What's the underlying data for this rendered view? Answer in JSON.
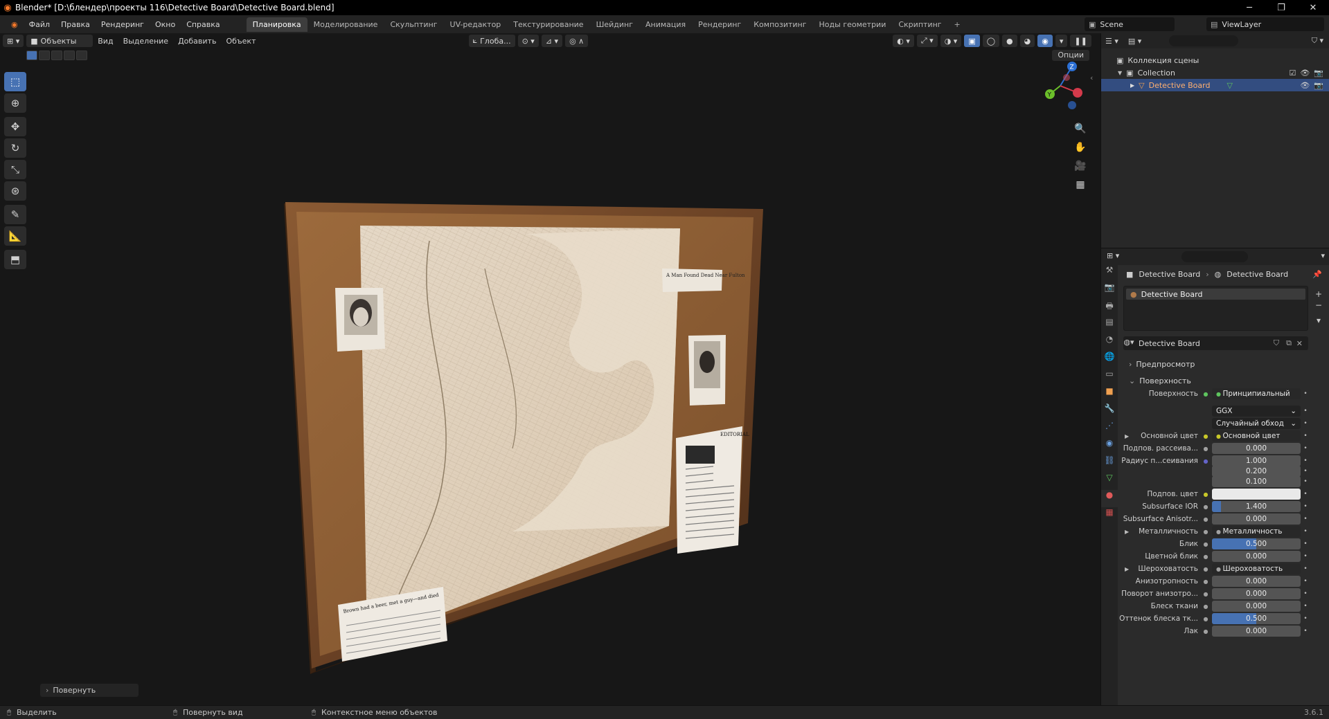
{
  "window": {
    "title": "Blender* [D:\\блендер\\проекты 116\\Detective Board\\Detective Board.blend]",
    "controls": [
      "─",
      "❐",
      "✕"
    ]
  },
  "menu": {
    "items": [
      "Файл",
      "Правка",
      "Рендеринг",
      "Окно",
      "Справка"
    ]
  },
  "workspaces": {
    "tabs": [
      "Планировка",
      "Моделирование",
      "Скульптинг",
      "UV-редактор",
      "Текстурирование",
      "Шейдинг",
      "Анимация",
      "Рендеринг",
      "Композитинг",
      "Ноды геометрии",
      "Скриптинг"
    ],
    "active": "Планировка",
    "add": "+"
  },
  "scene": {
    "name": "Scene",
    "view_layer": "ViewLayer"
  },
  "viewport": {
    "mode": "Объекты",
    "menus": [
      "Вид",
      "Выделение",
      "Добавить",
      "Объект"
    ],
    "orientation": "Глоба...",
    "options": "Опции",
    "last_operator": "Повернуть",
    "gizmo_axes": [
      "Z",
      "Y",
      "X"
    ],
    "board_clipping_titles": [
      "A Man Found Dead Near Fulton",
      "EDITORIAL",
      "Brown had a beer, met a guy—and died"
    ]
  },
  "outliner": {
    "scene_collection": "Коллекция сцены",
    "collection": "Collection",
    "object": "Detective Board"
  },
  "properties": {
    "breadcrumb_object": "Detective Board",
    "breadcrumb_material": "Detective Board",
    "material_slot": "Detective Board",
    "material_name": "Detective Board",
    "panel_preview": "Предпросмотр",
    "panel_surface": "Поверхность",
    "rows": [
      {
        "label": "Поверхность",
        "value": "Принципиальный BSDF",
        "kind": "sel",
        "sock": "#5ec45e"
      },
      {
        "label": "",
        "value": "GGX",
        "kind": "dark",
        "sock": ""
      },
      {
        "label": "",
        "value": "Случайный обход",
        "kind": "dark",
        "sock": ""
      },
      {
        "label": "Основной цвет",
        "value": "Основной цвет",
        "kind": "sel",
        "sock": "#c7c729",
        "arrow": true
      },
      {
        "label": "Подпов. рассеива...",
        "value": "0.000",
        "kind": "num",
        "sock": "#a1a1a1"
      },
      {
        "label": "Радиус п...сеивания",
        "value": "1.000",
        "kind": "num",
        "sock": "#6363c7"
      },
      {
        "label": "",
        "value": "0.200",
        "kind": "num",
        "sock": ""
      },
      {
        "label": "",
        "value": "0.100",
        "kind": "num",
        "sock": ""
      },
      {
        "label": "Подпов. цвет",
        "value": "",
        "kind": "white",
        "sock": "#c7c729"
      },
      {
        "label": "Subsurface IOR",
        "value": "1.400",
        "kind": "num",
        "sock": "#a1a1a1",
        "fill": 0.1
      },
      {
        "label": "Subsurface Anisotr...",
        "value": "0.000",
        "kind": "num",
        "sock": "#a1a1a1"
      },
      {
        "label": "Металличность",
        "value": "Металличность",
        "kind": "sel",
        "sock": "#a1a1a1",
        "arrow": true
      },
      {
        "label": "Блик",
        "value": "0.500",
        "kind": "num",
        "sock": "#a1a1a1",
        "fill": 0.5
      },
      {
        "label": "Цветной блик",
        "value": "0.000",
        "kind": "num",
        "sock": "#a1a1a1"
      },
      {
        "label": "Шероховатость",
        "value": "Шероховатость",
        "kind": "sel",
        "sock": "#a1a1a1",
        "arrow": true
      },
      {
        "label": "Анизотропность",
        "value": "0.000",
        "kind": "num",
        "sock": "#a1a1a1"
      },
      {
        "label": "Поворот анизотро...",
        "value": "0.000",
        "kind": "num",
        "sock": "#a1a1a1"
      },
      {
        "label": "Блеск ткани",
        "value": "0.000",
        "kind": "num",
        "sock": "#a1a1a1"
      },
      {
        "label": "Оттенок блеска тк...",
        "value": "0.500",
        "kind": "num",
        "sock": "#a1a1a1",
        "fill": 0.5
      },
      {
        "label": "Лак",
        "value": "0.000",
        "kind": "num",
        "sock": "#a1a1a1"
      }
    ]
  },
  "statusbar": {
    "select": "Выделить",
    "rotate_view": "Повернуть вид",
    "context_menu": "Контекстное меню объектов",
    "version": "3.6.1"
  },
  "colors": {
    "accent": "#4772b3",
    "selection": "#334d80",
    "brand": "#f5792a"
  }
}
